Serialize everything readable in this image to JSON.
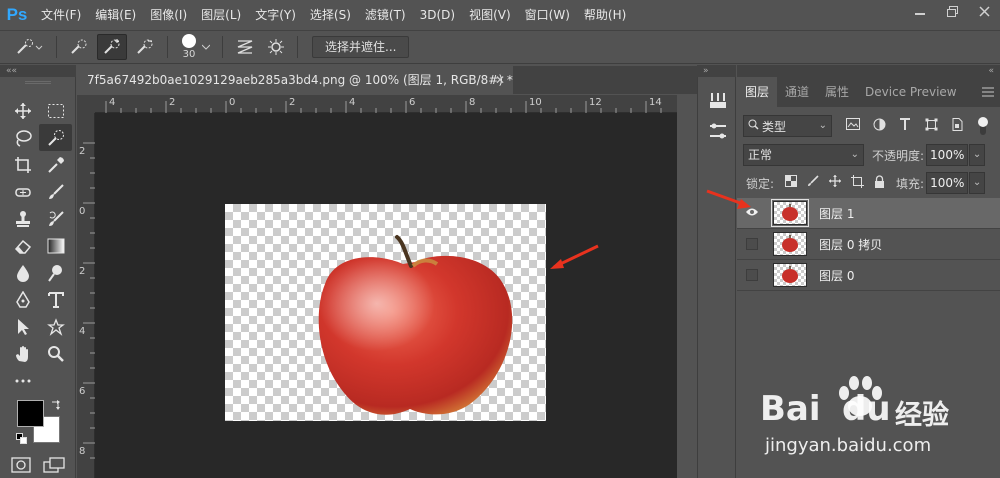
{
  "app": {
    "logo": "Ps"
  },
  "menu": [
    "文件(F)",
    "编辑(E)",
    "图像(I)",
    "图层(L)",
    "文字(Y)",
    "选择(S)",
    "滤镜(T)",
    "3D(D)",
    "视图(V)",
    "窗口(W)",
    "帮助(H)"
  ],
  "options": {
    "brush_size": "30",
    "select_mask_label": "选择并遮住..."
  },
  "document": {
    "tab_title": "7f5a67492b0ae1029129aeb285a3bd4.png @ 100% (图层 1, RGB/8#) *",
    "ruler_h": [
      "4",
      "2",
      "0",
      "2",
      "4",
      "6",
      "8",
      "10",
      "12",
      "14"
    ],
    "ruler_v": [
      "2",
      "0",
      "2",
      "4",
      "6",
      "8"
    ]
  },
  "layers_panel": {
    "tabs": [
      "图层",
      "通道",
      "属性",
      "Device Preview"
    ],
    "filter_kind": "类型",
    "blend_mode": "正常",
    "opacity_label": "不透明度:",
    "opacity_value": "100%",
    "lock_label": "锁定:",
    "fill_label": "填充:",
    "fill_value": "100%",
    "layers": [
      {
        "name": "图层 1",
        "visible": true,
        "selected": true
      },
      {
        "name": "图层 0 拷贝",
        "visible": false,
        "selected": false
      },
      {
        "name": "图层 0",
        "visible": false,
        "selected": false
      }
    ]
  },
  "watermark": {
    "brand": "Bai",
    "brand_tail": "du",
    "cn": "经验",
    "url": "jingyan.baidu.com"
  },
  "colors": {
    "accent": "#31a8ff",
    "arrow": "#e8321e",
    "canvas_bg": "#282828",
    "panel_bg": "#535353"
  }
}
